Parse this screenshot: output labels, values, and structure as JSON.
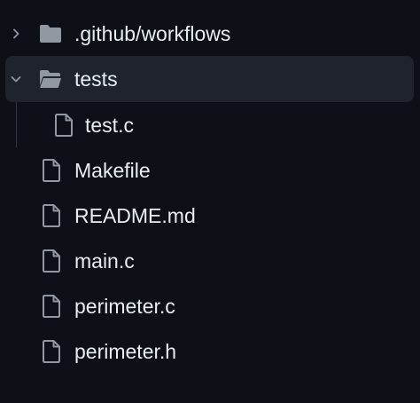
{
  "tree": {
    "items": [
      {
        "label": ".github/workflows",
        "kind": "folder",
        "icon": "folder-icon",
        "expanded": false
      },
      {
        "label": "tests",
        "kind": "folder",
        "icon": "folder-open-icon",
        "expanded": true,
        "selected": true
      },
      {
        "label": "test.c",
        "kind": "file",
        "icon": "file-icon",
        "depth": 1
      },
      {
        "label": "Makefile",
        "kind": "file",
        "icon": "file-icon"
      },
      {
        "label": "README.md",
        "kind": "file",
        "icon": "file-icon"
      },
      {
        "label": "main.c",
        "kind": "file",
        "icon": "file-icon"
      },
      {
        "label": "perimeter.c",
        "kind": "file",
        "icon": "file-icon"
      },
      {
        "label": "perimeter.h",
        "kind": "file",
        "icon": "file-icon"
      }
    ]
  },
  "colors": {
    "background": "#0d1117",
    "selected_row": "#1f242c",
    "text": "#e6edf3",
    "icon": "#9198a1",
    "guide": "#30363d"
  }
}
